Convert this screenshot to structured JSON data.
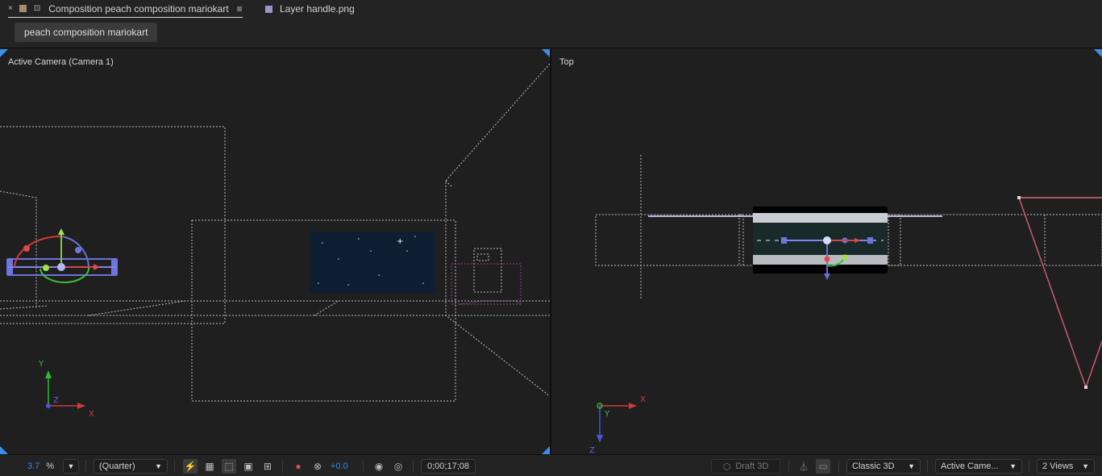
{
  "tabs": [
    {
      "label": "Composition peach composition mariokart",
      "swatch": "#a98b6a",
      "active": true
    },
    {
      "label": "Layer handle.png",
      "swatch": "#9b93c9",
      "active": false
    }
  ],
  "tab_icons": {
    "close": "×",
    "lock": "lock-icon",
    "menu": "≡"
  },
  "breadcrumb": {
    "label": "peach composition mariokart"
  },
  "views": {
    "left": {
      "label": "Active Camera (Camera 1)"
    },
    "right": {
      "label": "Top"
    }
  },
  "axes": {
    "x": "X",
    "y": "Y",
    "z": "Z"
  },
  "statusbar": {
    "zoom_value": "3.7",
    "zoom_unit": "%",
    "resolution": "(Quarter)",
    "exposure": "+0.0",
    "timecode": "0;00;17;08",
    "draft3d": "Draft 3D",
    "renderer": "Classic 3D",
    "camera": "Active Came...",
    "views": "2 Views"
  },
  "colors": {
    "accent": "#2d8ceb",
    "corner": "#3b8de8"
  }
}
